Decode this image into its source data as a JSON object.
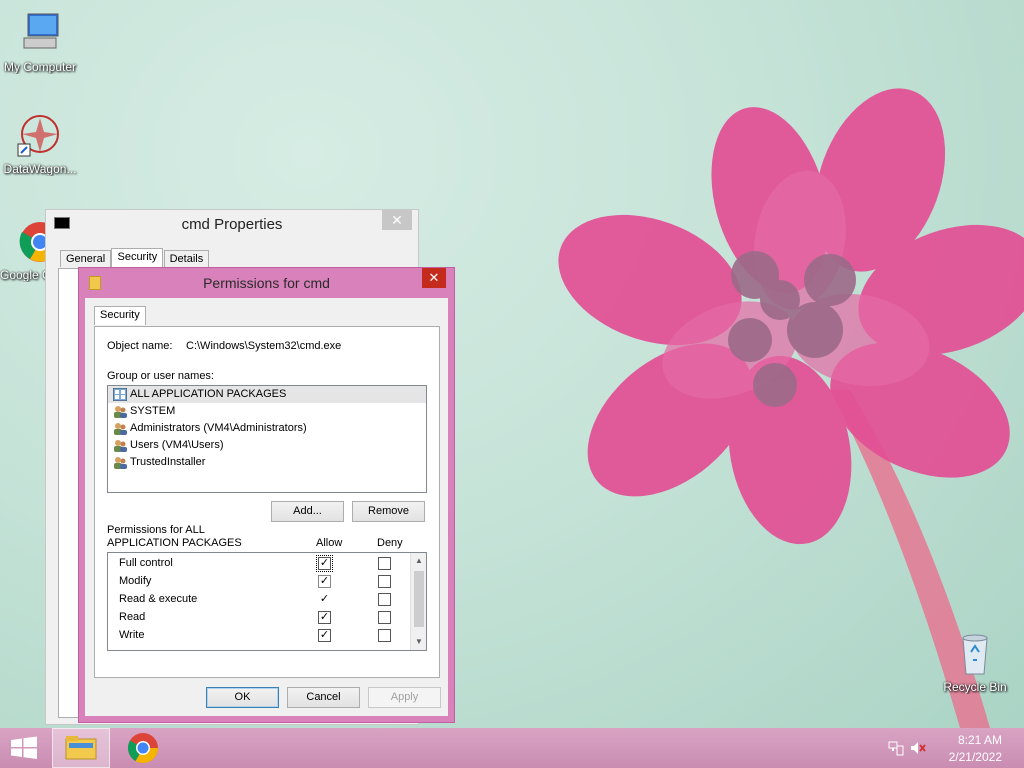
{
  "desktop": {
    "icons": [
      {
        "label": "My Computer",
        "icon": "computer-icon"
      },
      {
        "label": "DataWagon...",
        "icon": "datawagon-icon"
      },
      {
        "label": "Google Chrome",
        "icon": "chrome-icon"
      },
      {
        "label": "Recycle Bin",
        "icon": "recycle-bin-icon"
      }
    ]
  },
  "props_window": {
    "title": "cmd Properties",
    "close": "✕",
    "tabs": [
      "General",
      "Security",
      "Details"
    ]
  },
  "perm_dialog": {
    "title": "Permissions for cmd",
    "close": "✕",
    "tab": "Security",
    "object_label": "Object name:",
    "object_value": "C:\\Windows\\System32\\cmd.exe",
    "group_label": "Group or user names:",
    "groups": [
      {
        "name": "ALL APPLICATION PACKAGES",
        "selected": true
      },
      {
        "name": "SYSTEM",
        "selected": false
      },
      {
        "name": "Administrators (VM4\\Administrators)",
        "selected": false
      },
      {
        "name": "Users (VM4\\Users)",
        "selected": false
      },
      {
        "name": "TrustedInstaller",
        "selected": false
      }
    ],
    "add_button": "Add...",
    "remove_button": "Remove",
    "perms_label_1": "Permissions for ALL",
    "perms_label_2": "APPLICATION PACKAGES",
    "allow_header": "Allow",
    "deny_header": "Deny",
    "permissions": [
      {
        "name": "Full control",
        "allow": true,
        "deny": false
      },
      {
        "name": "Modify",
        "allow": true,
        "deny": false
      },
      {
        "name": "Read & execute",
        "allow": true,
        "deny": false
      },
      {
        "name": "Read",
        "allow": true,
        "deny": false
      },
      {
        "name": "Write",
        "allow": true,
        "deny": false
      }
    ],
    "ok_button": "OK",
    "cancel_button": "Cancel",
    "apply_button": "Apply"
  },
  "taskbar": {
    "time": "8:21 AM",
    "date": "2/21/2022"
  },
  "colors": {
    "accent": "#d881bb",
    "taskbar": "#c98db2",
    "close_red": "#c42b1c"
  }
}
